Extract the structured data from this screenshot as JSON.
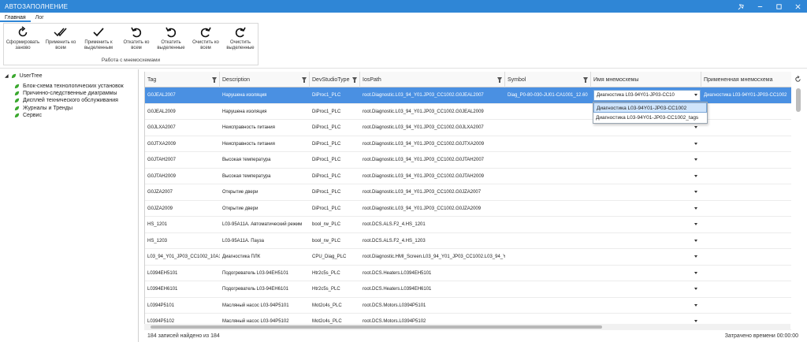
{
  "window": {
    "title": "АВТОЗАПОЛНЕНИЕ",
    "controls": [
      "minimize-icon",
      "maximize-icon",
      "close-icon"
    ]
  },
  "ribbon": {
    "tabs": [
      "Главная",
      "Лог"
    ],
    "active_tab": "Главная",
    "group_label": "Работа с мнемосхемами",
    "buttons": [
      {
        "label": "Сформировать заново",
        "icon": "refresh-icon"
      },
      {
        "label": "Применить ко всем",
        "icon": "double-check-icon"
      },
      {
        "label": "Применить к выделенным",
        "icon": "check-icon"
      },
      {
        "label": "Откатить ко всем",
        "icon": "undo-icon"
      },
      {
        "label": "Откатить выделенные",
        "icon": "undo-icon"
      },
      {
        "label": "Очистить ко всем",
        "icon": "redo-icon"
      },
      {
        "label": "Очистить выделенные",
        "icon": "redo-icon"
      }
    ]
  },
  "tree": {
    "root": "UserTree",
    "items": [
      "Блок-схема технологических установок",
      "Причинно-следственные диаграммы",
      "Дисплей технического обслуживания",
      "Журналы и Тренды",
      "Сервис"
    ],
    "colors": {
      "leaf": "#3aa82e"
    }
  },
  "grid": {
    "columns": [
      "Tag",
      "Description",
      "DevStudioType",
      "IosPath",
      "Symbol",
      "Имя мнемосхемы",
      "Примененная мнемосхема"
    ],
    "rows": [
      {
        "tag": "G0JEAL2007",
        "desc": "Нарушена изоляция",
        "type": "DiProc1_PLC",
        "path": "root.Diagnostic.L03_94_Y01.JP03_CC1002.G0JEAL2007",
        "symbol": "Diag_P0-80-030-JU01-CA1001_12.60",
        "mnemo": "Диагностика L03-94Y01-JP03-CC10",
        "applied": "Диагностика L03-94Y01-JP03-CC1002"
      },
      {
        "tag": "G0JEAL2009",
        "desc": "Нарушена изоляция",
        "type": "DiProc1_PLC",
        "path": "root.Diagnostic.L03_94_Y01.JP03_CC1002.G0JEAL2009",
        "symbol": "",
        "mnemo": "",
        "applied": ""
      },
      {
        "tag": "G0JLXA2007",
        "desc": "Неисправность питания",
        "type": "DiProc1_PLC",
        "path": "root.Diagnostic.L03_94_Y01.JP03_CC1002.G0JLXA2007",
        "symbol": "",
        "mnemo": "",
        "applied": ""
      },
      {
        "tag": "G0JTXA2009",
        "desc": "Неисправность питания",
        "type": "DiProc1_PLC",
        "path": "root.Diagnostic.L03_94_Y01.JP03_CC1002.G0JTXA2009",
        "symbol": "",
        "mnemo": "",
        "applied": ""
      },
      {
        "tag": "G0JTAH2007",
        "desc": "Высокая температура",
        "type": "DiProc1_PLC",
        "path": "root.Diagnostic.L03_94_Y01.JP03_CC1002.G0JTAH2007",
        "symbol": "",
        "mnemo": "",
        "applied": ""
      },
      {
        "tag": "G0JTAH2009",
        "desc": "Высокая температура",
        "type": "DiProc1_PLC",
        "path": "root.Diagnostic.L03_94_Y01.JP03_CC1002.G0JTAH2009",
        "symbol": "",
        "mnemo": "",
        "applied": ""
      },
      {
        "tag": "G0JZA2007",
        "desc": "Открытие двери",
        "type": "DiProc1_PLC",
        "path": "root.Diagnostic.L03_94_Y01.JP03_CC1002.G0JZA2007",
        "symbol": "",
        "mnemo": "",
        "applied": ""
      },
      {
        "tag": "G0JZA2009",
        "desc": "Открытие двери",
        "type": "DiProc1_PLC",
        "path": "root.Diagnostic.L03_94_Y01.JP03_CC1002.G0JZA2009",
        "symbol": "",
        "mnemo": "",
        "applied": ""
      },
      {
        "tag": "HS_1201",
        "desc": "L03-95A11A. Автоматический режим",
        "type": "bool_rw_PLC",
        "path": "root.DCS.ALS.F2_4.HS_1201",
        "symbol": "",
        "mnemo": "",
        "applied": ""
      },
      {
        "tag": "HS_1203",
        "desc": "L03-95A11A. Пауза",
        "type": "bool_rw_PLC",
        "path": "root.DCS.ALS.F2_4.HS_1203",
        "symbol": "",
        "mnemo": "",
        "applied": ""
      },
      {
        "tag": "L03_94_Y01_JP03_CC1002_10A1",
        "desc": "Диагностика ПЛК",
        "type": "CPU_Diag_PLC",
        "path": "root.Diagnostic.HMI_Screen.L03_94_Y01_JP03_CC1002.L03_94_Y",
        "symbol": "",
        "mnemo": "",
        "applied": ""
      },
      {
        "tag": "L0394EH5101",
        "desc": "Подогреватель L03-94EH5101",
        "type": "Htr2c5s_PLC",
        "path": "root.DCS.Heaters.L0394EH5101",
        "symbol": "",
        "mnemo": "",
        "applied": ""
      },
      {
        "tag": "L0394EH6101",
        "desc": "Подогреватель L03-94EH6101",
        "type": "Htr2c5s_PLC",
        "path": "root.DCS.Heaters.L0394EH6101",
        "symbol": "",
        "mnemo": "",
        "applied": ""
      },
      {
        "tag": "L0394P5101",
        "desc": "Масляный насос L03-94P5101",
        "type": "Mot2c4s_PLC",
        "path": "root.DCS.Motors.L0394P5101",
        "symbol": "",
        "mnemo": "",
        "applied": ""
      },
      {
        "tag": "L0394P5102",
        "desc": "Масляный насос L03-94P5102",
        "type": "Mot2c4s_PLC",
        "path": "root.DCS.Motors.L0394P5102",
        "symbol": "",
        "mnemo": "",
        "applied": ""
      }
    ],
    "dropdown_options": [
      "Диагностика L03-94Y01-JP03-CC1002",
      "Диагностика L03-94Y01-JP03-CC1002_tags"
    ]
  },
  "status": {
    "left": "184 записей найдено из 184",
    "right": "Затрачено времени 00:00:00"
  },
  "colors": {
    "accent": "#2f86d6",
    "selection": "#4a90e2"
  }
}
